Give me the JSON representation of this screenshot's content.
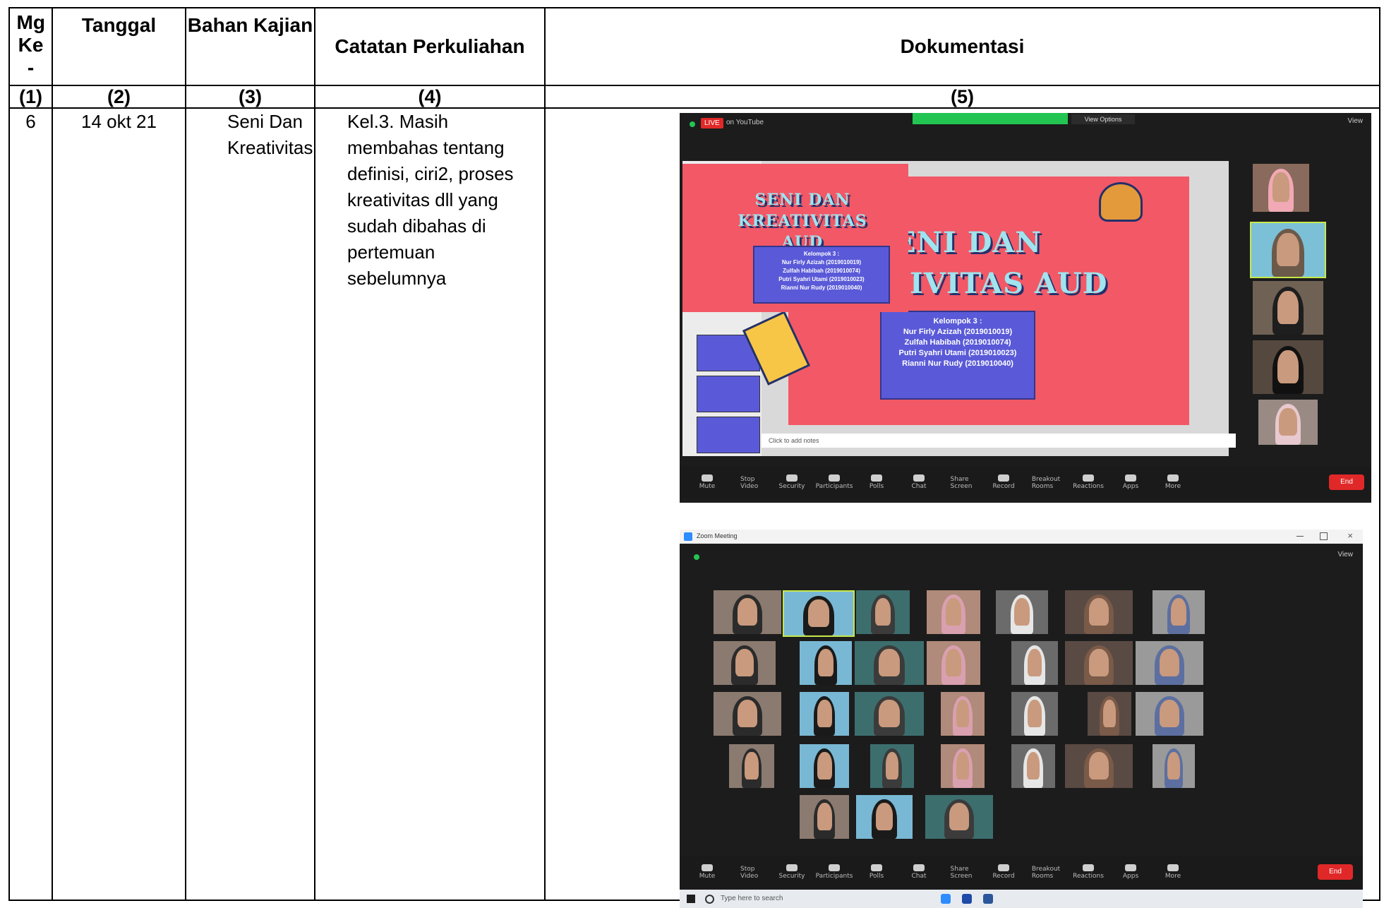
{
  "table": {
    "headers": {
      "week": "Mg Ke -",
      "date": "Tanggal",
      "topic": "Bahan Kajian",
      "notes": "Catatan Perkuliahan",
      "documentation": "Dokumentasi"
    },
    "column_numbers": [
      "(1)",
      "(2)",
      "(3)",
      "(4)",
      "(5)"
    ],
    "row": {
      "week": "6",
      "date": "14 okt 21",
      "topic": "Seni Dan Kreativitas",
      "notes": "Kel.3. Masih membahas tentang definisi, ciri2, proses kreativitas dll yang sudah dibahas di pertemuan sebelumnya"
    }
  },
  "screenshot1": {
    "live_badge": "LIVE",
    "live_dest": "on YouTube",
    "view_options": "View Options",
    "view_label": "View",
    "slide_title_small": "SENI DAN KREATIVITAS AUD",
    "slide_title_big_line1": "ENI DAN",
    "slide_title_big_line2": "IVITAS AUD",
    "group_label": "Kelompok 3 :",
    "members": [
      "Nur Firly Azizah (2019010019)",
      "Zulfah Habibah (2019010074)",
      "Putri Syahri Utami (2019010023)",
      "Rianni Nur Rudy (2019010040)"
    ],
    "notes_placeholder": "Click to add notes",
    "end_label": "End"
  },
  "screenshot2": {
    "window_title": "Zoom Meeting",
    "view_label": "View",
    "search_placeholder": "Type here to search",
    "end_label": "End"
  },
  "toolbar_labels": [
    "Mute",
    "Stop Video",
    "Security",
    "Participants",
    "Polls",
    "Chat",
    "Share Screen",
    "Record",
    "Breakout Rooms",
    "Reactions",
    "Apps",
    "More"
  ],
  "colors": {
    "slide_bg": "#f25866",
    "slide_title": "#9fe4ee",
    "zoom_green": "#23c552",
    "end_red": "#e02828"
  }
}
